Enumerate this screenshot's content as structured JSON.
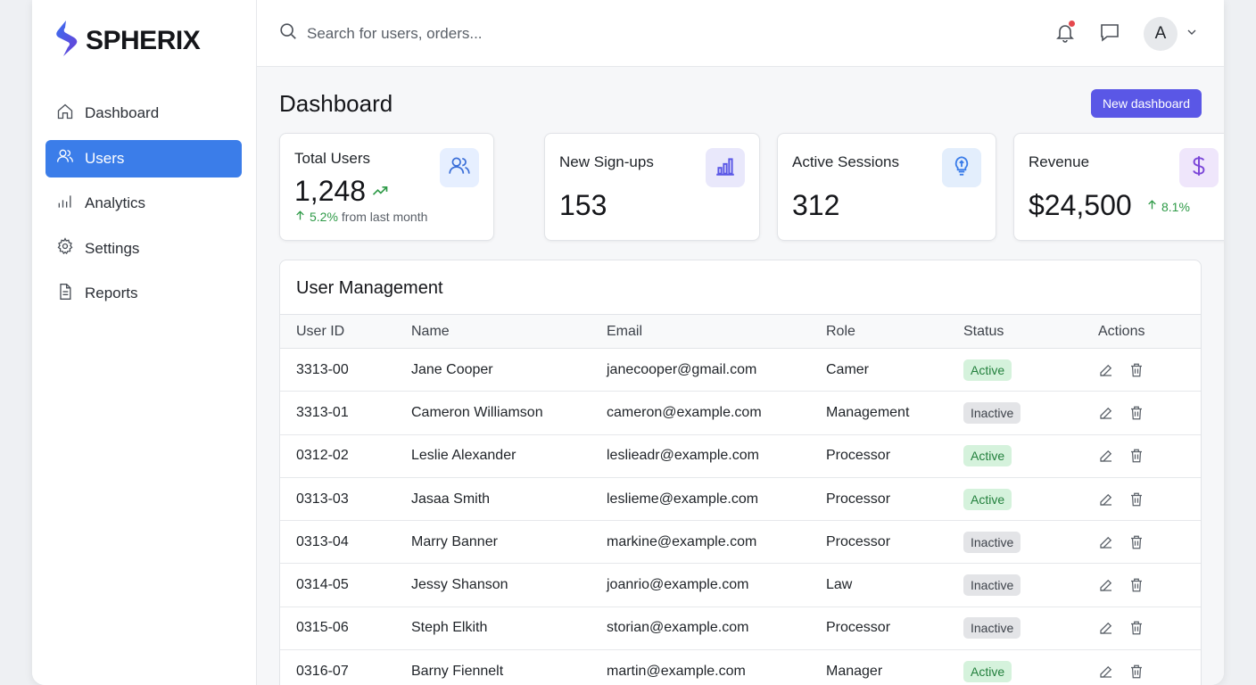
{
  "brand": {
    "name": "SPHERIX",
    "logo_colors": [
      "#3a6ff0",
      "#6a3fd6"
    ]
  },
  "sidebar": {
    "items": [
      {
        "label": "Dashboard",
        "icon": "home-icon",
        "active": false
      },
      {
        "label": "Users",
        "icon": "users-icon",
        "active": true
      },
      {
        "label": "Analytics",
        "icon": "bar-chart-icon",
        "active": false
      },
      {
        "label": "Settings",
        "icon": "gear-icon",
        "active": false
      },
      {
        "label": "Reports",
        "icon": "document-icon",
        "active": false
      }
    ]
  },
  "topbar": {
    "search_placeholder": "Search for users, orders...",
    "avatar_initial": "A",
    "notification_dot": true
  },
  "page": {
    "title": "Dashboard",
    "new_button": "New dashboard"
  },
  "stats": [
    {
      "label": "Total Users",
      "value": "1,248",
      "sub_change": "5.2%",
      "sub_text": "from last month",
      "icon": "users-icon"
    },
    {
      "label": "New Sign-ups",
      "value": "153",
      "icon": "bar-chart-icon"
    },
    {
      "label": "Active Sessions",
      "value": "312",
      "icon": "lightbulb-icon"
    },
    {
      "label": "Revenue",
      "value": "$24,500",
      "change": "8.1%",
      "icon": "dollar-icon"
    }
  ],
  "table": {
    "title": "User Management",
    "headers": [
      "User ID",
      "Name",
      "Email",
      "Role",
      "Status",
      "Actions"
    ],
    "rows": [
      {
        "id": "3313-00",
        "name": "Jane Cooper",
        "email": "janecooper@gmail.com",
        "role": "Camer",
        "status": "Active"
      },
      {
        "id": "3313-01",
        "name": "Cameron Williamson",
        "email": "cameron@example.com",
        "role": "Management",
        "status": "Inactive"
      },
      {
        "id": "0312-02",
        "name": "Leslie Alexander",
        "email": "leslieadr@example.com",
        "role": "Processor",
        "status": "Active"
      },
      {
        "id": "0313-03",
        "name": "Jasaa Smith",
        "email": "leslieme@example.com",
        "role": "Processor",
        "status": "Active"
      },
      {
        "id": "0313-04",
        "name": "Marry Banner",
        "email": "markine@example.com",
        "role": "Processor",
        "status": "Inactive"
      },
      {
        "id": "0314-05",
        "name": "Jessy Shanson",
        "email": "joanrio@example.com",
        "role": "Law",
        "status": "Inactive"
      },
      {
        "id": "0315-06",
        "name": "Steph Elkith",
        "email": "storian@example.com",
        "role": "Processor",
        "status": "Inactive"
      },
      {
        "id": "0316-07",
        "name": "Barny Fiennelt",
        "email": "martin@example.com",
        "role": "Manager",
        "status": "Active"
      }
    ]
  },
  "colors": {
    "accent": "#3b7de9",
    "primary_button": "#5a57e6",
    "active_badge": "#d5f2dc",
    "inactive_badge": "#e3e4e7",
    "trend_up": "#2e9a47"
  }
}
